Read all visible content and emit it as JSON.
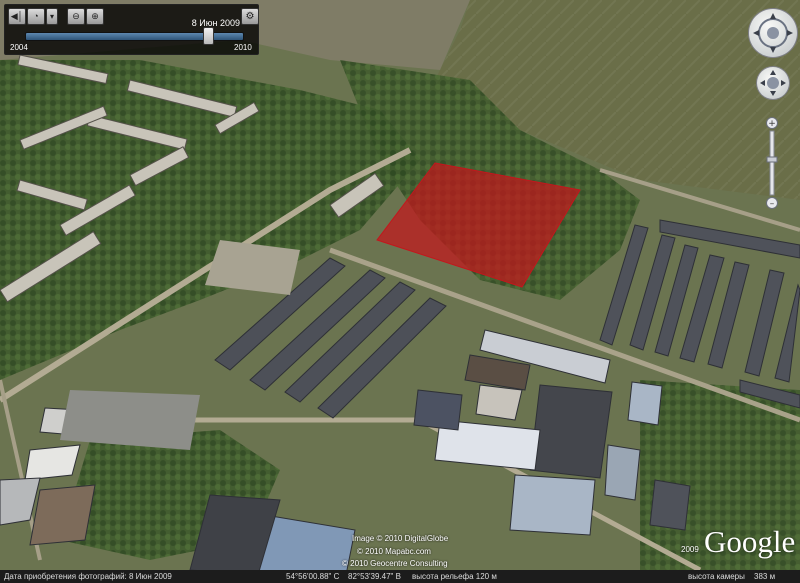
{
  "time_slider": {
    "date_label": "8 Июн 2009",
    "start_year": "2004",
    "end_year": "2010",
    "position": 0.84
  },
  "attribution": {
    "line1": "Image © 2010 DigitalGlobe",
    "line2": "© 2010 Mapabc.com",
    "line3": "© 2010 Geocentre Consulting",
    "logo_year": "2009",
    "logo": "Google"
  },
  "status_bar": {
    "photo_date": "Дата приобретения фотографий: 8 Июн 2009",
    "latitude": "54°56'00.88\" С",
    "longitude": "82°53'39.47\" В",
    "elevation": "высота рельефа  120 м",
    "eye_alt": "высота камеры",
    "eye_alt_value": "383 м"
  },
  "highlight_color": "#c4161c",
  "icons": {
    "play": "play-icon",
    "clock": "clock-icon",
    "zoom_out": "zoom-out-icon",
    "zoom_in": "zoom-in-icon",
    "settings": "wrench-icon",
    "compass": "compass-icon",
    "look": "look-joystick-icon",
    "move": "move-joystick-icon"
  }
}
